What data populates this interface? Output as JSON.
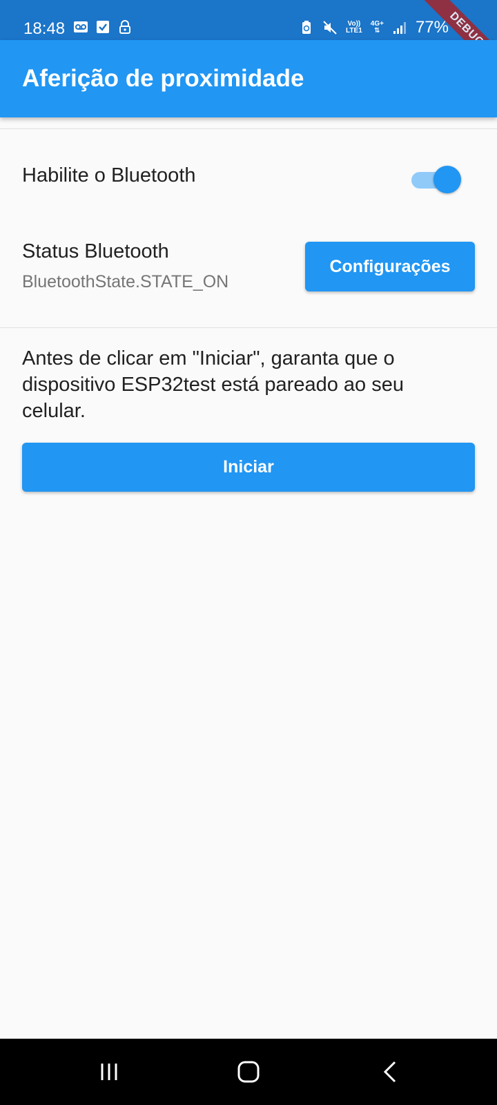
{
  "status_bar": {
    "time": "18:48",
    "battery": "77%",
    "network_top": "Vo))",
    "network_bottom": "LTE1",
    "network_gen": "4G+",
    "icons_left": [
      "voicemail-icon",
      "checkbox-icon",
      "lock-icon"
    ],
    "icons_right": [
      "battery-saver-icon",
      "mute-icon",
      "volte-icon",
      "4g-icon",
      "signal-icon",
      "battery-icon"
    ]
  },
  "debug_banner": "DEBUG",
  "app_bar": {
    "title": "Aferição de proximidade",
    "color": "#2196f3"
  },
  "bluetooth_toggle": {
    "label": "Habilite o Bluetooth",
    "enabled": true
  },
  "bluetooth_status": {
    "label": "Status Bluetooth",
    "value": "BluetoothState.STATE_ON",
    "settings_button": "Configurações"
  },
  "instruction": "Antes de clicar em \"Iniciar\", garanta que o dispositivo ESP32test está pareado ao seu celular.",
  "start_button": "Iniciar",
  "nav_bar": {
    "icons": [
      "recent-apps-icon",
      "home-icon",
      "back-icon"
    ]
  }
}
